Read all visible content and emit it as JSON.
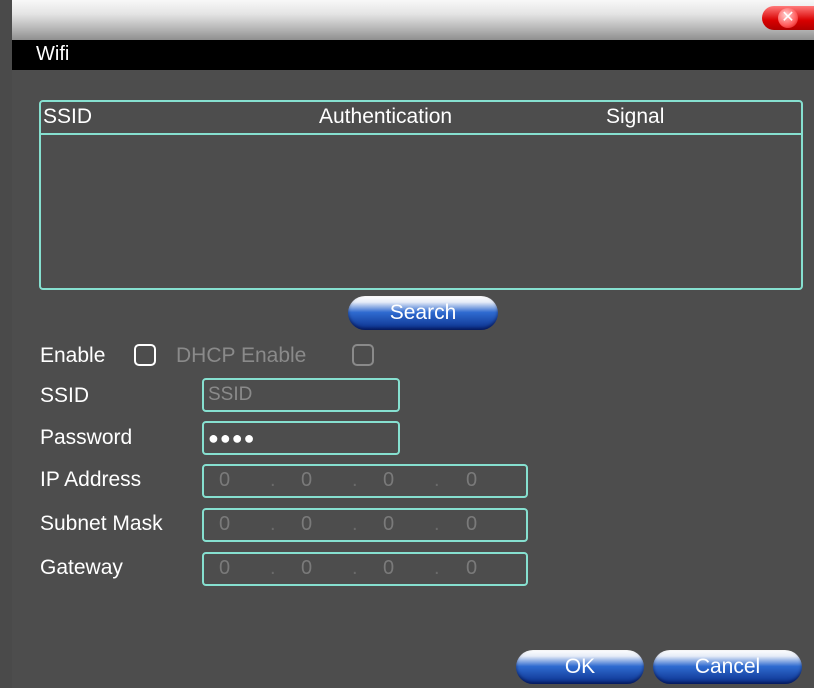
{
  "window": {
    "title": "Wifi",
    "close_symbol": "✕"
  },
  "network_list": {
    "columns": [
      "SSID",
      "Authentication",
      "Signal"
    ],
    "rows": []
  },
  "buttons": {
    "search": "Search",
    "ok": "OK",
    "cancel": "Cancel"
  },
  "form": {
    "enable_label": "Enable",
    "enable_checked": false,
    "dhcp_label": "DHCP Enable",
    "dhcp_checked": false,
    "ssid_label": "SSID",
    "ssid_placeholder": "SSID",
    "password_label": "Password",
    "password_value": "●●●●",
    "ip_label": "IP Address",
    "subnet_label": "Subnet Mask",
    "gateway_label": "Gateway",
    "ip_address": [
      "0",
      "0",
      "0",
      "0"
    ],
    "subnet_mask": [
      "0",
      "0",
      "0",
      "0"
    ],
    "gateway": [
      "0",
      "0",
      "0",
      "0"
    ],
    "ip_separator": "."
  },
  "colors": {
    "accent_border": "#86e0d0",
    "background": "#4d4d4d",
    "title_bar": "#000000",
    "disabled_text": "#8a8a8a"
  }
}
